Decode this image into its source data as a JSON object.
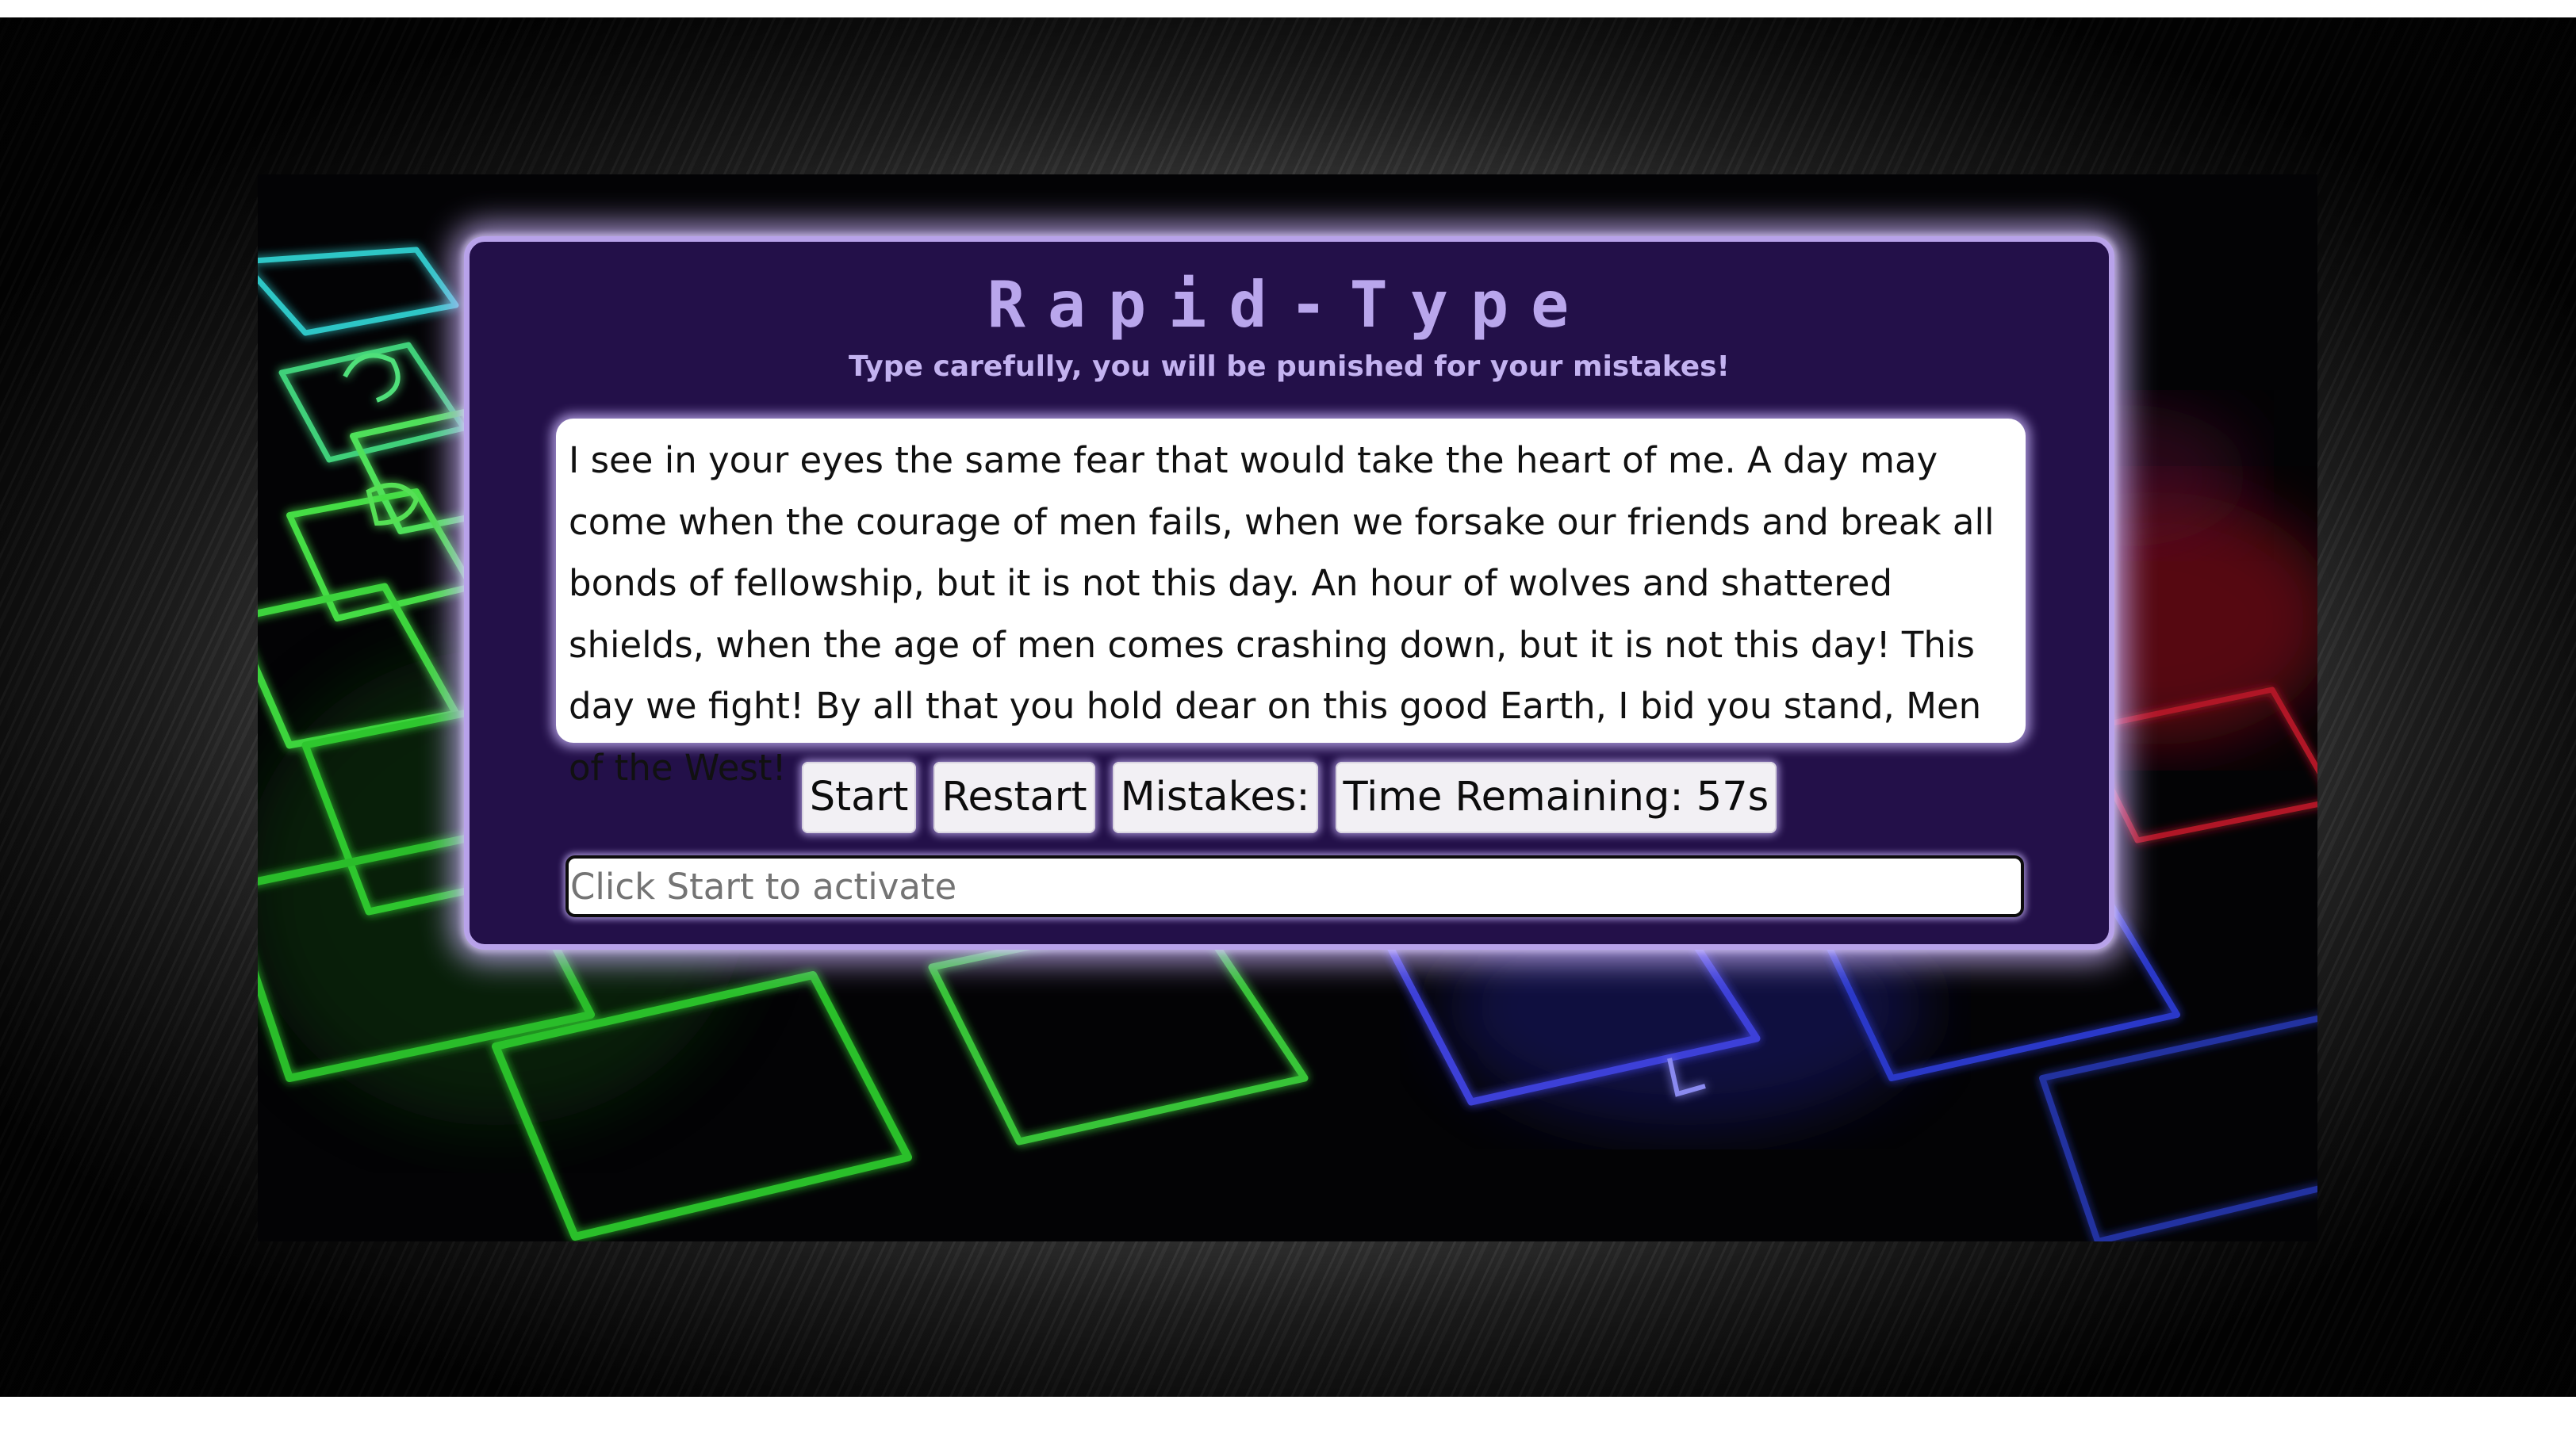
{
  "app": {
    "title": "Rapid-Type",
    "subtitle": "Type carefully, you will be punished for your mistakes!"
  },
  "quote": {
    "text": "I see in your eyes the same fear that would take the heart of me. A day may come when the courage of men fails, when we forsake our friends and break all bonds of fellowship, but it is not this day. An hour of wolves and shattered shields, when the age of men comes crashing down, but it is not this day! This day we fight! By all that you hold dear on this good Earth, I bid you stand, Men of the West!"
  },
  "controls": {
    "start_label": "Start",
    "restart_label": "Restart",
    "mistakes_label": "Mistakes:",
    "time_label": "Time Remaining: 57s"
  },
  "input": {
    "placeholder": "Click Start to activate",
    "value": ""
  },
  "colors": {
    "panel_bg": "#231049",
    "panel_border": "#b8a2ea",
    "title_color": "#b9a6ec",
    "glow": "#ceb6ff"
  },
  "icons": {
    "background": "backlit-keyboard-photo"
  }
}
